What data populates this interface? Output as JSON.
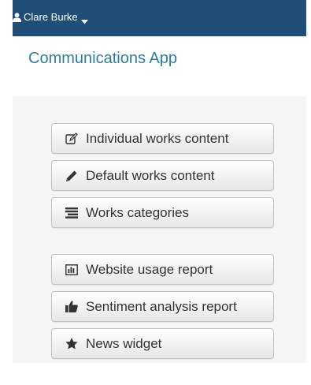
{
  "navbar": {
    "user": {
      "name": "Clare Burke",
      "icon": "user-icon",
      "caret": "caret-down-icon"
    },
    "background": "#1f4f78"
  },
  "header": {
    "title": "Communications App",
    "color": "#2a7fa0"
  },
  "menu": {
    "group1": [
      {
        "label": "Individual works content",
        "icon": "edit-icon"
      },
      {
        "label": "Default works content",
        "icon": "pencil-icon"
      },
      {
        "label": "Works categories",
        "icon": "list-icon"
      }
    ],
    "group2": [
      {
        "label": "Website usage report",
        "icon": "bar-chart-icon"
      },
      {
        "label": "Sentiment analysis report",
        "icon": "thumbs-up-icon"
      },
      {
        "label": "News widget",
        "icon": "star-icon"
      }
    ]
  }
}
